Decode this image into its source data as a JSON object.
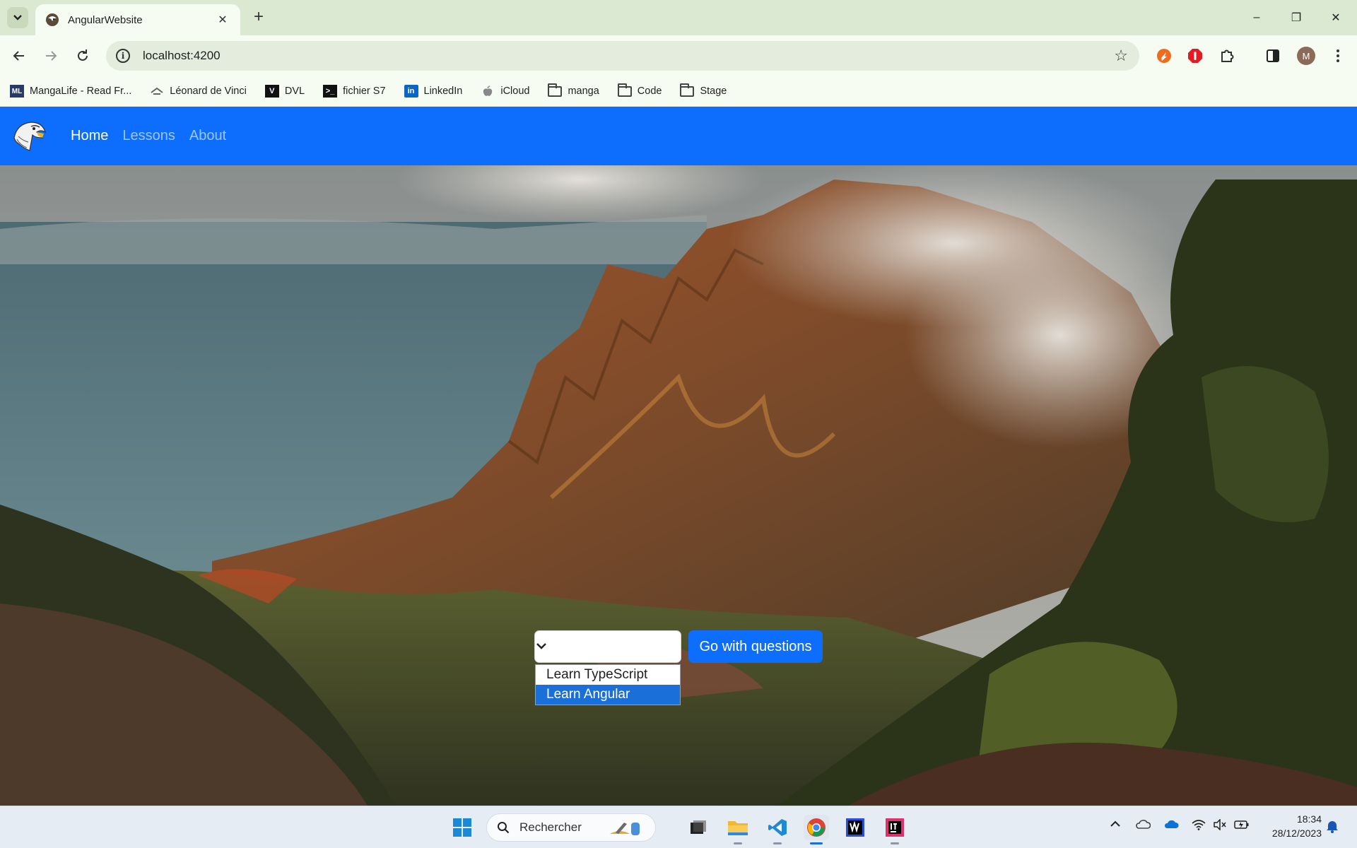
{
  "browser": {
    "tab_title": "AngularWebsite",
    "tab_close": "✕",
    "new_tab": "+",
    "url": "localhost:4200",
    "window_controls": [
      "–",
      "❐",
      "✕"
    ]
  },
  "bookmarks": [
    {
      "label": "MangaLife - Read Fr...",
      "icon": "mangalife-icon"
    },
    {
      "label": "Léonard de Vinci",
      "icon": "devinci-icon"
    },
    {
      "label": "DVL",
      "icon": "dvl-icon"
    },
    {
      "label": "fichier S7",
      "icon": "terminal-icon"
    },
    {
      "label": "LinkedIn",
      "icon": "linkedin-icon"
    },
    {
      "label": "iCloud",
      "icon": "apple-icon"
    },
    {
      "label": "manga",
      "icon": "folder-icon"
    },
    {
      "label": "Code",
      "icon": "folder-icon"
    },
    {
      "label": "Stage",
      "icon": "folder-icon"
    }
  ],
  "app": {
    "nav": {
      "home": "Home",
      "lessons": "Lessons",
      "about": "About"
    },
    "select": {
      "current_value": "",
      "options": [
        "Learn TypeScript",
        "Learn Angular"
      ],
      "highlighted_option": "Learn Angular"
    },
    "go_button": "Go with questions",
    "navbar_color": "#0d6efd"
  },
  "taskbar": {
    "search_placeholder": "Rechercher",
    "time": "18:34",
    "date": "28/12/2023"
  }
}
